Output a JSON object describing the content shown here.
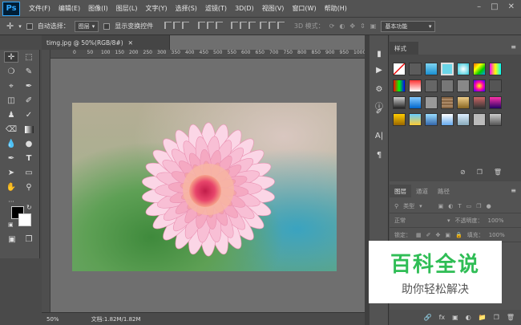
{
  "app": {
    "logo": "Ps"
  },
  "menu": [
    "文件(F)",
    "编辑(E)",
    "图像(I)",
    "图层(L)",
    "文字(Y)",
    "选择(S)",
    "滤镜(T)",
    "3D(D)",
    "视图(V)",
    "窗口(W)",
    "帮助(H)"
  ],
  "options": {
    "auto_select_label": "自动选择：",
    "auto_select_value": "图层",
    "show_transform_label": "显示变换控件",
    "mode3d_label": "3D 模式：",
    "workspace_value": "基本功能"
  },
  "document": {
    "tab_title": "timg.jpg @ 50%(RGB/8#)",
    "ruler_marks": [
      "0",
      "50",
      "100",
      "150",
      "200",
      "250",
      "300",
      "350",
      "400",
      "450",
      "500",
      "550",
      "600",
      "650",
      "700",
      "750",
      "800",
      "850",
      "900",
      "950",
      "1000"
    ],
    "zoom": "50%",
    "doc_size": "文档:1.82M/1.82M"
  },
  "styles_panel": {
    "tab": "样式"
  },
  "layers_panel": {
    "tabs": [
      "图层",
      "通道",
      "路径"
    ],
    "filter_label": "类型",
    "blend_mode": "正常",
    "opacity_label": "不透明度：",
    "opacity_value": "100%",
    "lock_label": "锁定：",
    "fill_label": "填充：",
    "fill_value": "100%"
  },
  "watermark": {
    "title": "百科全说",
    "subtitle": "助你轻松解决"
  },
  "colors": {
    "accent": "#31a8ff",
    "watermark_green": "#2fbd55",
    "panel_bg": "#535353"
  }
}
